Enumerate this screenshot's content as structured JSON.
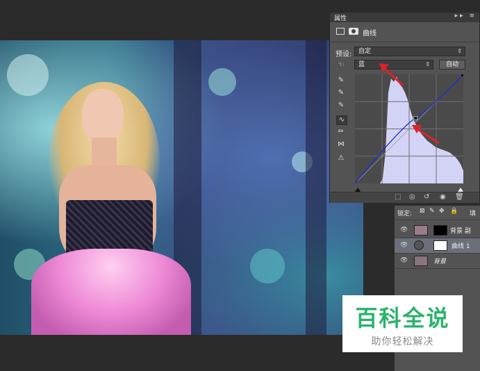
{
  "properties_panel": {
    "tab_label": "属性",
    "tab_icons": "▸▸ ≡",
    "adjustment_title": "曲线",
    "preset_label": "预设:",
    "preset_value": "自定",
    "channel_value": "蓝",
    "auto_button": "自动"
  },
  "layers_panel": {
    "lock_label": "锁定:",
    "fill_label": "填",
    "layers": [
      {
        "name": "背景 副",
        "thumb_color": "#9a7b8a",
        "mask": true
      },
      {
        "name": "曲线 1",
        "thumb_color": "#ffffff",
        "mask": true,
        "selected": true
      },
      {
        "name": "背景",
        "thumb_color": "#8a7480",
        "mask": false
      }
    ]
  },
  "watermark": {
    "title": "百科全说",
    "subtitle": "助你轻松解决"
  },
  "colors": {
    "histogram_fill": "#d3d4f5",
    "curve_line": "#1f2ad8",
    "arrow": "#e0202a",
    "watermark_green": "#28b36a"
  },
  "curve": {
    "input_points": [
      [
        0,
        0
      ],
      [
        0.56,
        0.6
      ],
      [
        1,
        1
      ]
    ]
  }
}
